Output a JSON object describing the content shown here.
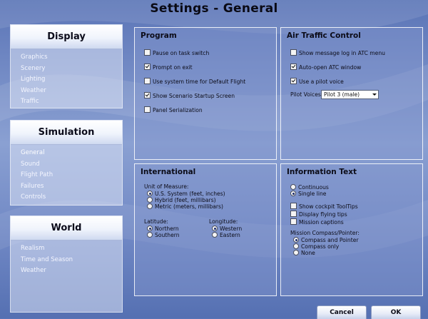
{
  "window": {
    "title": "Settings - General"
  },
  "nav": {
    "display": {
      "header": "Display",
      "items": [
        "Graphics",
        "Scenery",
        "Lighting",
        "Weather",
        "Traffic"
      ]
    },
    "simulation": {
      "header": "Simulation",
      "items": [
        "General",
        "Sound",
        "Flight Path",
        "Failures",
        "Controls"
      ],
      "active": "General"
    },
    "world": {
      "header": "World",
      "items": [
        "Realism",
        "Time and Season",
        "Weather"
      ]
    }
  },
  "program": {
    "title": "Program",
    "pause_on_task_switch": {
      "label": "Pause on task switch",
      "checked": false
    },
    "prompt_on_exit": {
      "label": "Prompt on exit",
      "checked": true
    },
    "use_system_time": {
      "label": "Use system time for Default Flight",
      "checked": false
    },
    "show_scenario_startup": {
      "label": "Show Scenario Startup Screen",
      "checked": true
    },
    "panel_serialization": {
      "label": "Panel Serialization",
      "checked": false
    }
  },
  "atc": {
    "title": "Air Traffic Control",
    "show_message_log": {
      "label": "Show message log in ATC menu",
      "checked": false
    },
    "auto_open_atc": {
      "label": "Auto-open ATC window",
      "checked": true
    },
    "use_pilot_voice": {
      "label": "Use a pilot voice",
      "checked": true
    },
    "pilot_voices_label": "Pilot Voices:",
    "pilot_voices_value": "Pilot 3 (male)"
  },
  "international": {
    "title": "International",
    "unit_label": "Unit of Measure:",
    "units": [
      {
        "label": "U.S. System (feet, inches)",
        "checked": true
      },
      {
        "label": "Hybrid (feet, millibars)",
        "checked": false
      },
      {
        "label": "Metric (meters, millibars)",
        "checked": false
      }
    ],
    "latitude_label": "Latitude:",
    "latitude": [
      {
        "label": "Northern",
        "checked": true
      },
      {
        "label": "Southern",
        "checked": false
      }
    ],
    "longitude_label": "Longitude:",
    "longitude": [
      {
        "label": "Western",
        "checked": true
      },
      {
        "label": "Eastern",
        "checked": false
      }
    ]
  },
  "info_text": {
    "title": "Information Text",
    "display_mode": [
      {
        "label": "Continuous",
        "checked": false
      },
      {
        "label": "Single line",
        "checked": true
      }
    ],
    "show_cockpit_tooltips": {
      "label": "Show cockpit ToolTips",
      "checked": false
    },
    "display_flying_tips": {
      "label": "Display flying tips",
      "checked": false
    },
    "mission_captions": {
      "label": "Mission captions",
      "checked": false
    },
    "compass_label": "Mission Compass/Pointer:",
    "compass": [
      {
        "label": "Compass and Pointer",
        "checked": true
      },
      {
        "label": "Compass only",
        "checked": false
      },
      {
        "label": "None",
        "checked": false
      }
    ]
  },
  "footer": {
    "cancel_label": "Cancel",
    "ok_label": "OK"
  },
  "colors": {
    "background": "#6e86c2",
    "panel_border": "#ffffff",
    "header_bar": "#f0f4fc"
  }
}
